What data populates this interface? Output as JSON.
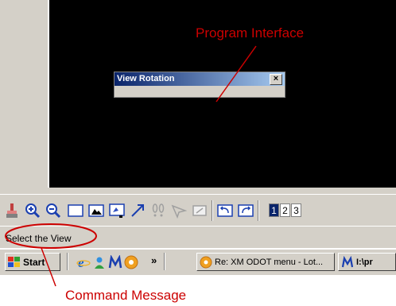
{
  "dialog": {
    "title": "View Rotation",
    "close_glyph": "×"
  },
  "toolbar": {
    "icons": [
      "paintbrush-icon",
      "zoom-in-icon",
      "zoom-out-icon",
      "window-area-icon",
      "fit-view-icon",
      "pan-icon",
      "rotate-icon",
      "walk-icon",
      "select-pointer-icon",
      "copy-view-icon",
      "undo-view-icon",
      "redo-view-icon"
    ],
    "view_numbers": [
      "1",
      "2",
      "3"
    ]
  },
  "status": {
    "message": "Select the View"
  },
  "taskbar": {
    "start_label": "Start",
    "overflow_glyph": "»",
    "task1_label": "Re: XM ODOT menu - Lot...",
    "task2_label": "I:\\pr"
  },
  "annotations": {
    "program_interface": "Program Interface",
    "command_message": "Command Message",
    "color": "#cc0000"
  }
}
